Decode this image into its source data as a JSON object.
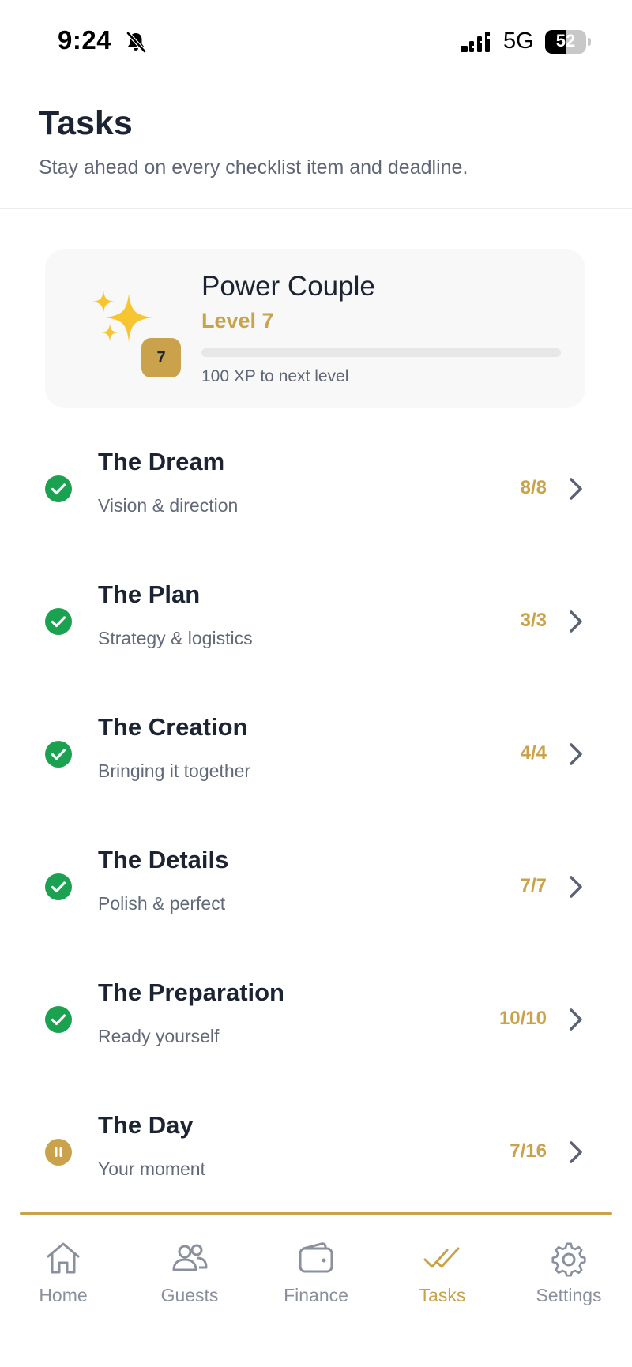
{
  "status_bar": {
    "time": "9:24",
    "network": "5G",
    "battery_percent": "52",
    "battery_level": 0.52
  },
  "header": {
    "title": "Tasks",
    "subtitle": "Stay ahead on every checklist item and deadline."
  },
  "level_card": {
    "name": "Power Couple",
    "level_label": "Level 7",
    "badge": "7",
    "xp_progress": 0.0,
    "xp_caption": "100 XP to next level"
  },
  "tasks": [
    {
      "title": "The Dream",
      "subtitle": "Vision & direction",
      "count": "8/8",
      "status": "complete"
    },
    {
      "title": "The Plan",
      "subtitle": "Strategy & logistics",
      "count": "3/3",
      "status": "complete"
    },
    {
      "title": "The Creation",
      "subtitle": "Bringing it together",
      "count": "4/4",
      "status": "complete"
    },
    {
      "title": "The Details",
      "subtitle": "Polish & perfect",
      "count": "7/7",
      "status": "complete"
    },
    {
      "title": "The Preparation",
      "subtitle": "Ready yourself",
      "count": "10/10",
      "status": "complete"
    },
    {
      "title": "The Day",
      "subtitle": "Your moment",
      "count": "7/16",
      "status": "in-progress"
    }
  ],
  "nav": {
    "items": [
      {
        "label": "Home",
        "icon": "home-icon"
      },
      {
        "label": "Guests",
        "icon": "guests-icon"
      },
      {
        "label": "Finance",
        "icon": "wallet-icon"
      },
      {
        "label": "Tasks",
        "icon": "double-check-icon"
      },
      {
        "label": "Settings",
        "icon": "gear-icon"
      }
    ],
    "active": "Tasks"
  },
  "colors": {
    "accent": "#c9a24b",
    "complete": "#1aa251",
    "text": "#1c2433",
    "muted": "#626977",
    "card_bg": "#f8f8f9"
  }
}
